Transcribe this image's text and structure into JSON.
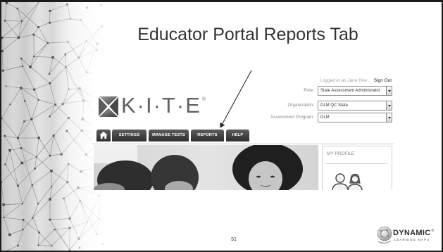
{
  "slide": {
    "title": "Educator Portal Reports Tab",
    "page_number": "51"
  },
  "portal": {
    "logo_icon": "kite-logo-icon",
    "logo_text": "K·I·T·E",
    "logo_mark": "®",
    "user_status": "Logged in as Jane Doe ,",
    "sign_out": "Sign Out",
    "filters": [
      {
        "label": "Role:",
        "value": "State Assessment Administrator"
      },
      {
        "label": "Organization:",
        "value": "DLM QC State"
      },
      {
        "label": "Assessment Program:",
        "value": "DLM"
      }
    ],
    "nav": {
      "home_icon": "home-icon",
      "tabs": [
        "SETTINGS",
        "MANAGE TESTS",
        "REPORTS",
        "HELP"
      ]
    },
    "profile": {
      "title": "MY PROFILE",
      "icon": "people-icon"
    }
  },
  "brand": {
    "icon": "dynamic-learning-maps-logo-icon",
    "name": "DYNAMIC",
    "mark": "®",
    "tagline": "LEARNING MAPS"
  },
  "colors": {
    "title": "#333333",
    "nav_tab": "#3a3a3a",
    "frame": "#1b1b1b"
  }
}
